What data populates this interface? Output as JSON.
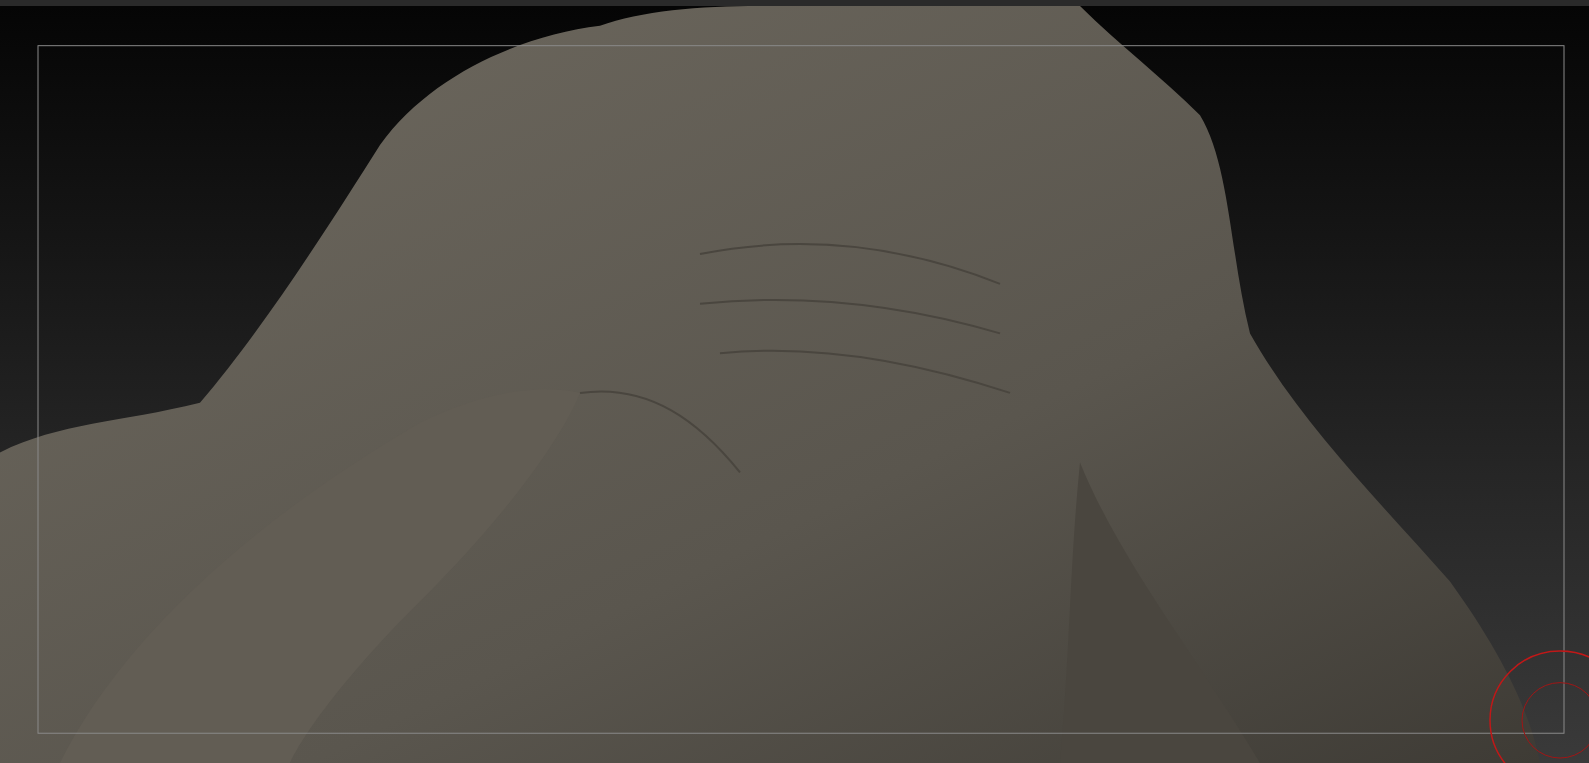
{
  "viewport": {
    "frame_visible": true,
    "brush_cursor": true
  }
}
